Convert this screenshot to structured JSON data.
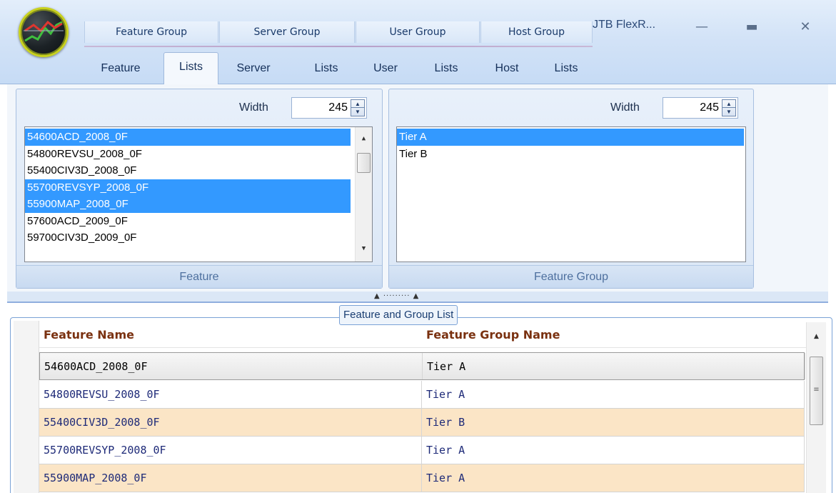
{
  "app": {
    "title": "JTB FlexR..."
  },
  "window_controls": {
    "minimize": "—",
    "maximize": "▬",
    "close": "✕"
  },
  "ribbon": {
    "groups": [
      "Feature Group",
      "Server Group",
      "User Group",
      "Host Group"
    ],
    "tabs": [
      "Feature",
      "Lists",
      "Server",
      "Lists",
      "User",
      "Lists",
      "Host",
      "Lists"
    ],
    "active_tab_index": 1
  },
  "feature_panel": {
    "width_label": "Width",
    "width_value": "245",
    "caption": "Feature",
    "items": [
      {
        "label": "54600ACD_2008_0F",
        "selected": true
      },
      {
        "label": "54800REVSU_2008_0F",
        "selected": false
      },
      {
        "label": "55400CIV3D_2008_0F",
        "selected": false
      },
      {
        "label": "55700REVSYP_2008_0F",
        "selected": true
      },
      {
        "label": "55900MAP_2008_0F",
        "selected": true
      },
      {
        "label": "57600ACD_2009_0F",
        "selected": false
      },
      {
        "label": "59700CIV3D_2009_0F",
        "selected": false
      }
    ]
  },
  "group_panel": {
    "width_label": "Width",
    "width_value": "245",
    "caption": "Feature Group",
    "items": [
      {
        "label": "Tier A",
        "selected": true
      },
      {
        "label": "Tier B",
        "selected": false
      }
    ]
  },
  "grid": {
    "legend": "Feature and Group List",
    "columns": [
      "Feature Name",
      "Feature Group Name"
    ],
    "rows": [
      [
        "54600ACD_2008_0F",
        "Tier A"
      ],
      [
        "54800REVSU_2008_0F",
        "Tier A"
      ],
      [
        "55400CIV3D_2008_0F",
        "Tier B"
      ],
      [
        "55700REVSYP_2008_0F",
        "Tier A"
      ],
      [
        "55900MAP_2008_0F",
        "Tier A"
      ]
    ]
  },
  "colors": {
    "selection": "#3399ff",
    "alt_row": "#fbe5c6",
    "header_text": "#7a3110",
    "ribbon_bg": "#d3e3f7"
  }
}
